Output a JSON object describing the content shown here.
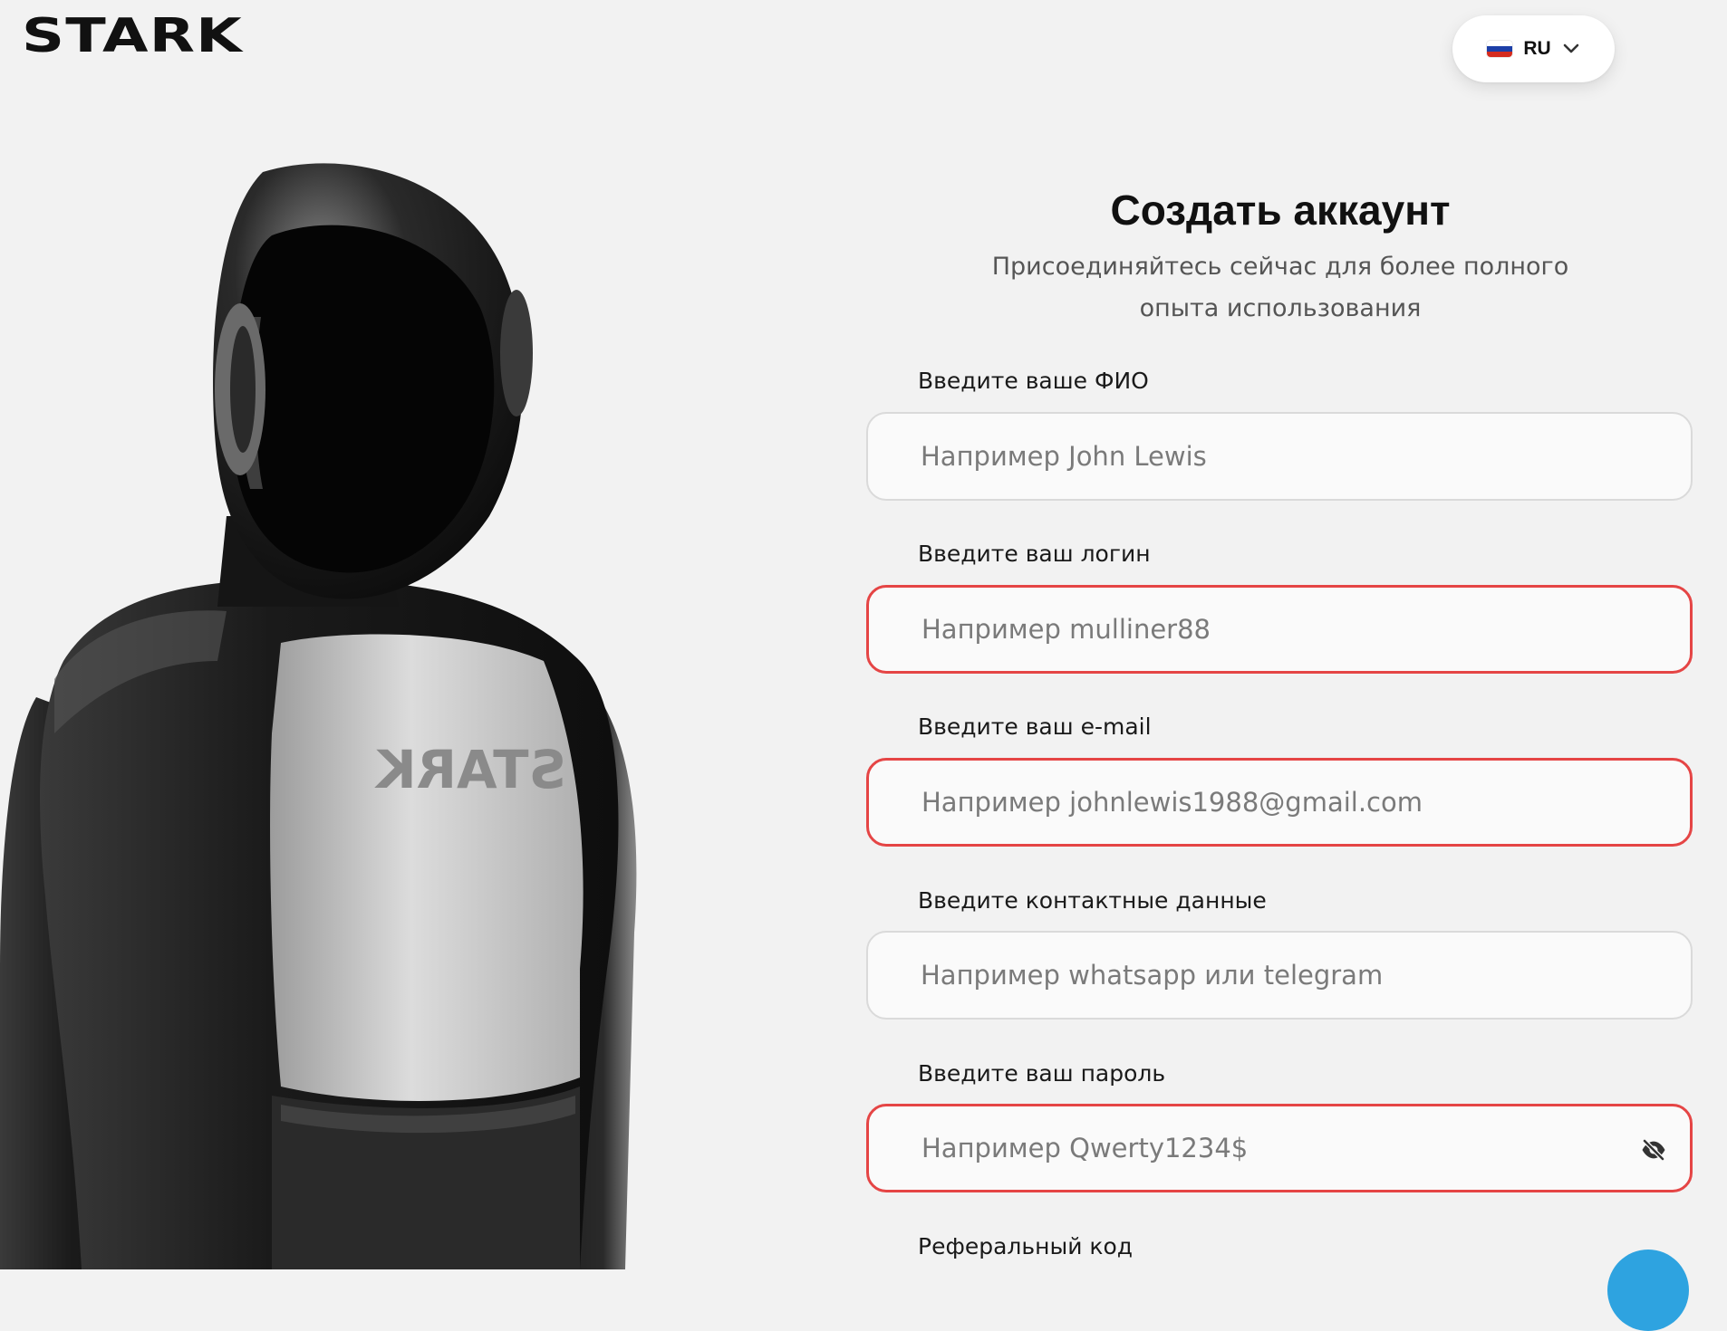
{
  "header": {
    "logo_text": "STARK",
    "language": {
      "code": "RU",
      "flag": [
        "#ffffff",
        "#1c3fa8",
        "#d52b1e"
      ]
    }
  },
  "hero": {
    "torso_text": "STARK",
    "colors": {
      "shell": "#1b1b1b",
      "visor": "#050505",
      "chest": "#c8c8c8"
    }
  },
  "form": {
    "title": "Создать аккаунт",
    "subtitle_line1": "Присоединяйтесь сейчас для более полного",
    "subtitle_line2": "опыта использования",
    "fields": {
      "fullname": {
        "label": "Введите ваше ФИО",
        "placeholder": "Например John Lewis",
        "value": "",
        "state": "normal"
      },
      "login": {
        "label": "Введите ваш логин",
        "placeholder": "Например mulliner88",
        "value": "",
        "state": "error"
      },
      "email": {
        "label": "Введите ваш e-mail",
        "placeholder": "Например johnlewis1988@gmail.com",
        "value": "",
        "state": "error"
      },
      "contacts": {
        "label": "Введите контактные данные",
        "placeholder": "Например whatsapp или telegram",
        "value": "",
        "state": "normal"
      },
      "password": {
        "label": "Введите ваш пароль",
        "placeholder": "Например Qwerty1234$",
        "value": "",
        "state": "error",
        "toggle_icon": "eye-off-icon"
      },
      "referral": {
        "label": "Реферальный код"
      }
    },
    "error_color": "#e54545"
  },
  "support_button": {
    "color": "#2ea3e0"
  }
}
